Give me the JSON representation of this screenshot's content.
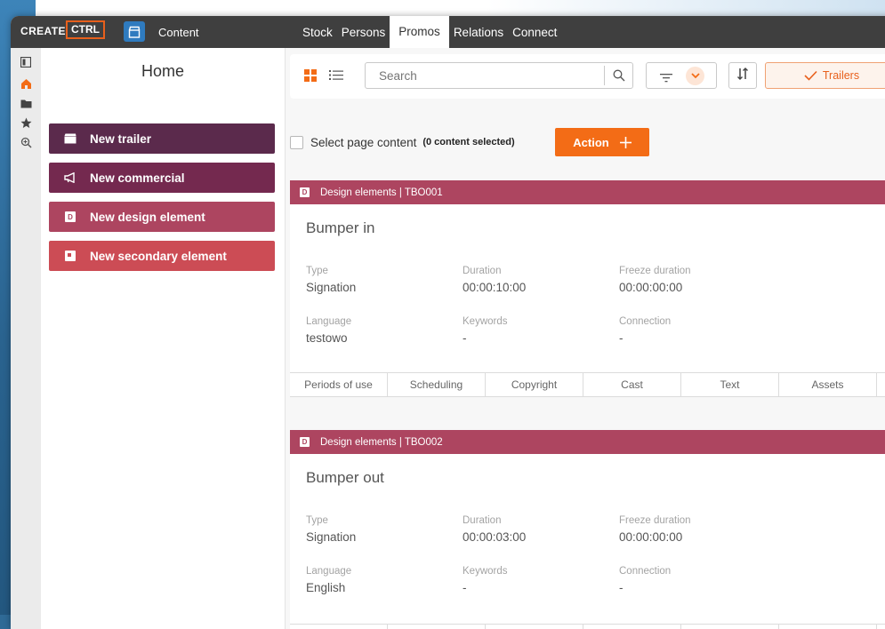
{
  "brand": {
    "create": "CREATE",
    "ctrl": "CTRL"
  },
  "app": {
    "content_label": "Content"
  },
  "tabs": [
    {
      "label": "Stock"
    },
    {
      "label": "Persons"
    },
    {
      "label": "Promos",
      "active": true
    },
    {
      "label": "Relations"
    },
    {
      "label": "Connect"
    }
  ],
  "rail": [
    "panel-toggle-icon",
    "home-icon",
    "folder-icon",
    "star-icon",
    "zoom-icon"
  ],
  "sidebar": {
    "title": "Home",
    "buttons": [
      {
        "label": "New trailer",
        "color": "#5b2a4c"
      },
      {
        "label": "New commercial",
        "color": "#74294f"
      },
      {
        "label": "New design element",
        "color": "#ad4560"
      },
      {
        "label": "New secondary element",
        "color": "#cc4c55"
      }
    ]
  },
  "toolbar": {
    "search_placeholder": "Search",
    "trailers_label": "Trailers"
  },
  "selection": {
    "label": "Select page content",
    "count": "(0 content selected)",
    "action_label": "Action"
  },
  "cards": [
    {
      "header": "Design elements | TBO001",
      "title": "Bumper in",
      "fields": [
        {
          "label": "Type",
          "value": "Signation"
        },
        {
          "label": "Duration",
          "value": "00:00:10:00"
        },
        {
          "label": "Freeze duration",
          "value": "00:00:00:00"
        },
        {
          "label": "Language",
          "value": "testowo"
        },
        {
          "label": "Keywords",
          "value": "-"
        },
        {
          "label": "Connection",
          "value": "-"
        }
      ],
      "tabs": [
        "Periods of use",
        "Scheduling",
        "Copyright",
        "Cast",
        "Text",
        "Assets"
      ]
    },
    {
      "header": "Design elements | TBO002",
      "title": "Bumper out",
      "fields": [
        {
          "label": "Type",
          "value": "Signation"
        },
        {
          "label": "Duration",
          "value": "00:00:03:00"
        },
        {
          "label": "Freeze duration",
          "value": "00:00:00:00"
        },
        {
          "label": "Language",
          "value": "English"
        },
        {
          "label": "Keywords",
          "value": "-"
        },
        {
          "label": "Connection",
          "value": "-"
        }
      ]
    }
  ],
  "colors": {
    "accent": "#f36c16",
    "card_header": "#ad4560",
    "topbar": "#3f3f3f"
  }
}
